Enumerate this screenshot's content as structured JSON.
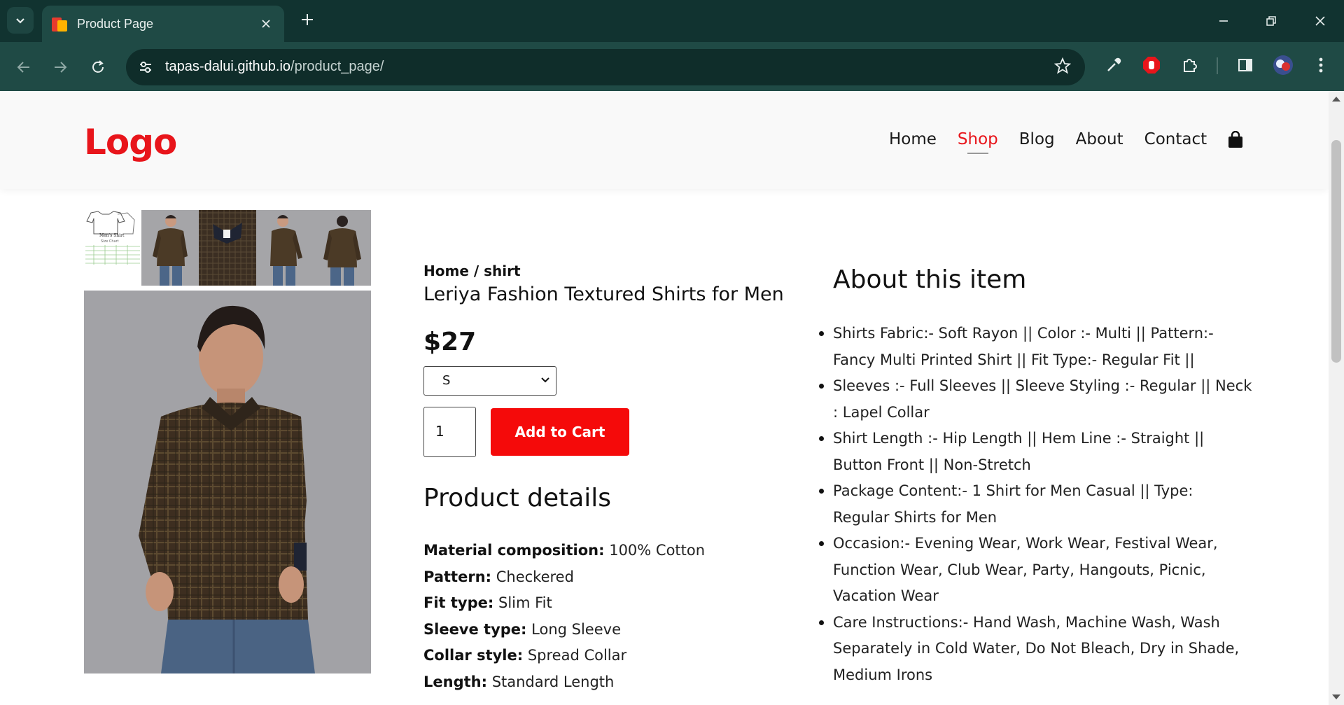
{
  "browser": {
    "tab_title": "Product Page",
    "url_host": "tapas-dalui.github.io",
    "url_path": "/product_page/"
  },
  "header": {
    "logo": "Logo",
    "nav": [
      "Home",
      "Shop",
      "Blog",
      "About",
      "Contact"
    ],
    "active_nav": "Shop"
  },
  "product": {
    "breadcrumb": "Home / shirt",
    "title": "Leriya Fashion Textured Shirts for Men",
    "price": "$27",
    "size_selected": "S",
    "quantity": "1",
    "add_to_cart": "Add to Cart",
    "details_heading": "Product details",
    "details": [
      {
        "label": "Material composition:",
        "value": "100% Cotton"
      },
      {
        "label": "Pattern:",
        "value": "Checkered"
      },
      {
        "label": "Fit type:",
        "value": "Slim Fit"
      },
      {
        "label": "Sleeve type:",
        "value": "Long Sleeve"
      },
      {
        "label": "Collar style:",
        "value": "Spread Collar"
      },
      {
        "label": "Length:",
        "value": "Standard Length"
      }
    ]
  },
  "about": {
    "heading": "About this item",
    "items": [
      "Shirts Fabric:- Soft Rayon || Color :- Multi || Pattern:- Fancy Multi Printed Shirt || Fit Type:- Regular Fit ||",
      "Sleeves :- Full Sleeves || Sleeve Styling :- Regular || Neck : Lapel Collar",
      "Shirt Length :- Hip Length || Hem Line :- Straight || Button Front || Non-Stretch",
      "Package Content:- 1 Shirt for Men Casual || Type: Regular Shirts for Men",
      "Occasion:- Evening Wear, Work Wear, Festival Wear, Function Wear, Club Wear, Party, Hangouts, Picnic, Vacation Wear",
      "Care Instructions:- Hand Wash, Machine Wash, Wash Separately in Cold Water, Do Not Bleach, Dry in Shade, Medium Irons"
    ]
  },
  "thumbnail_text": {
    "title": "Men's Shirt",
    "subtitle": "Size Chart"
  },
  "colors": {
    "chrome_dark": "#113330",
    "chrome_toolbar": "#1f4a45",
    "brand_red": "#e8151b",
    "button_red": "#f50a0a"
  }
}
